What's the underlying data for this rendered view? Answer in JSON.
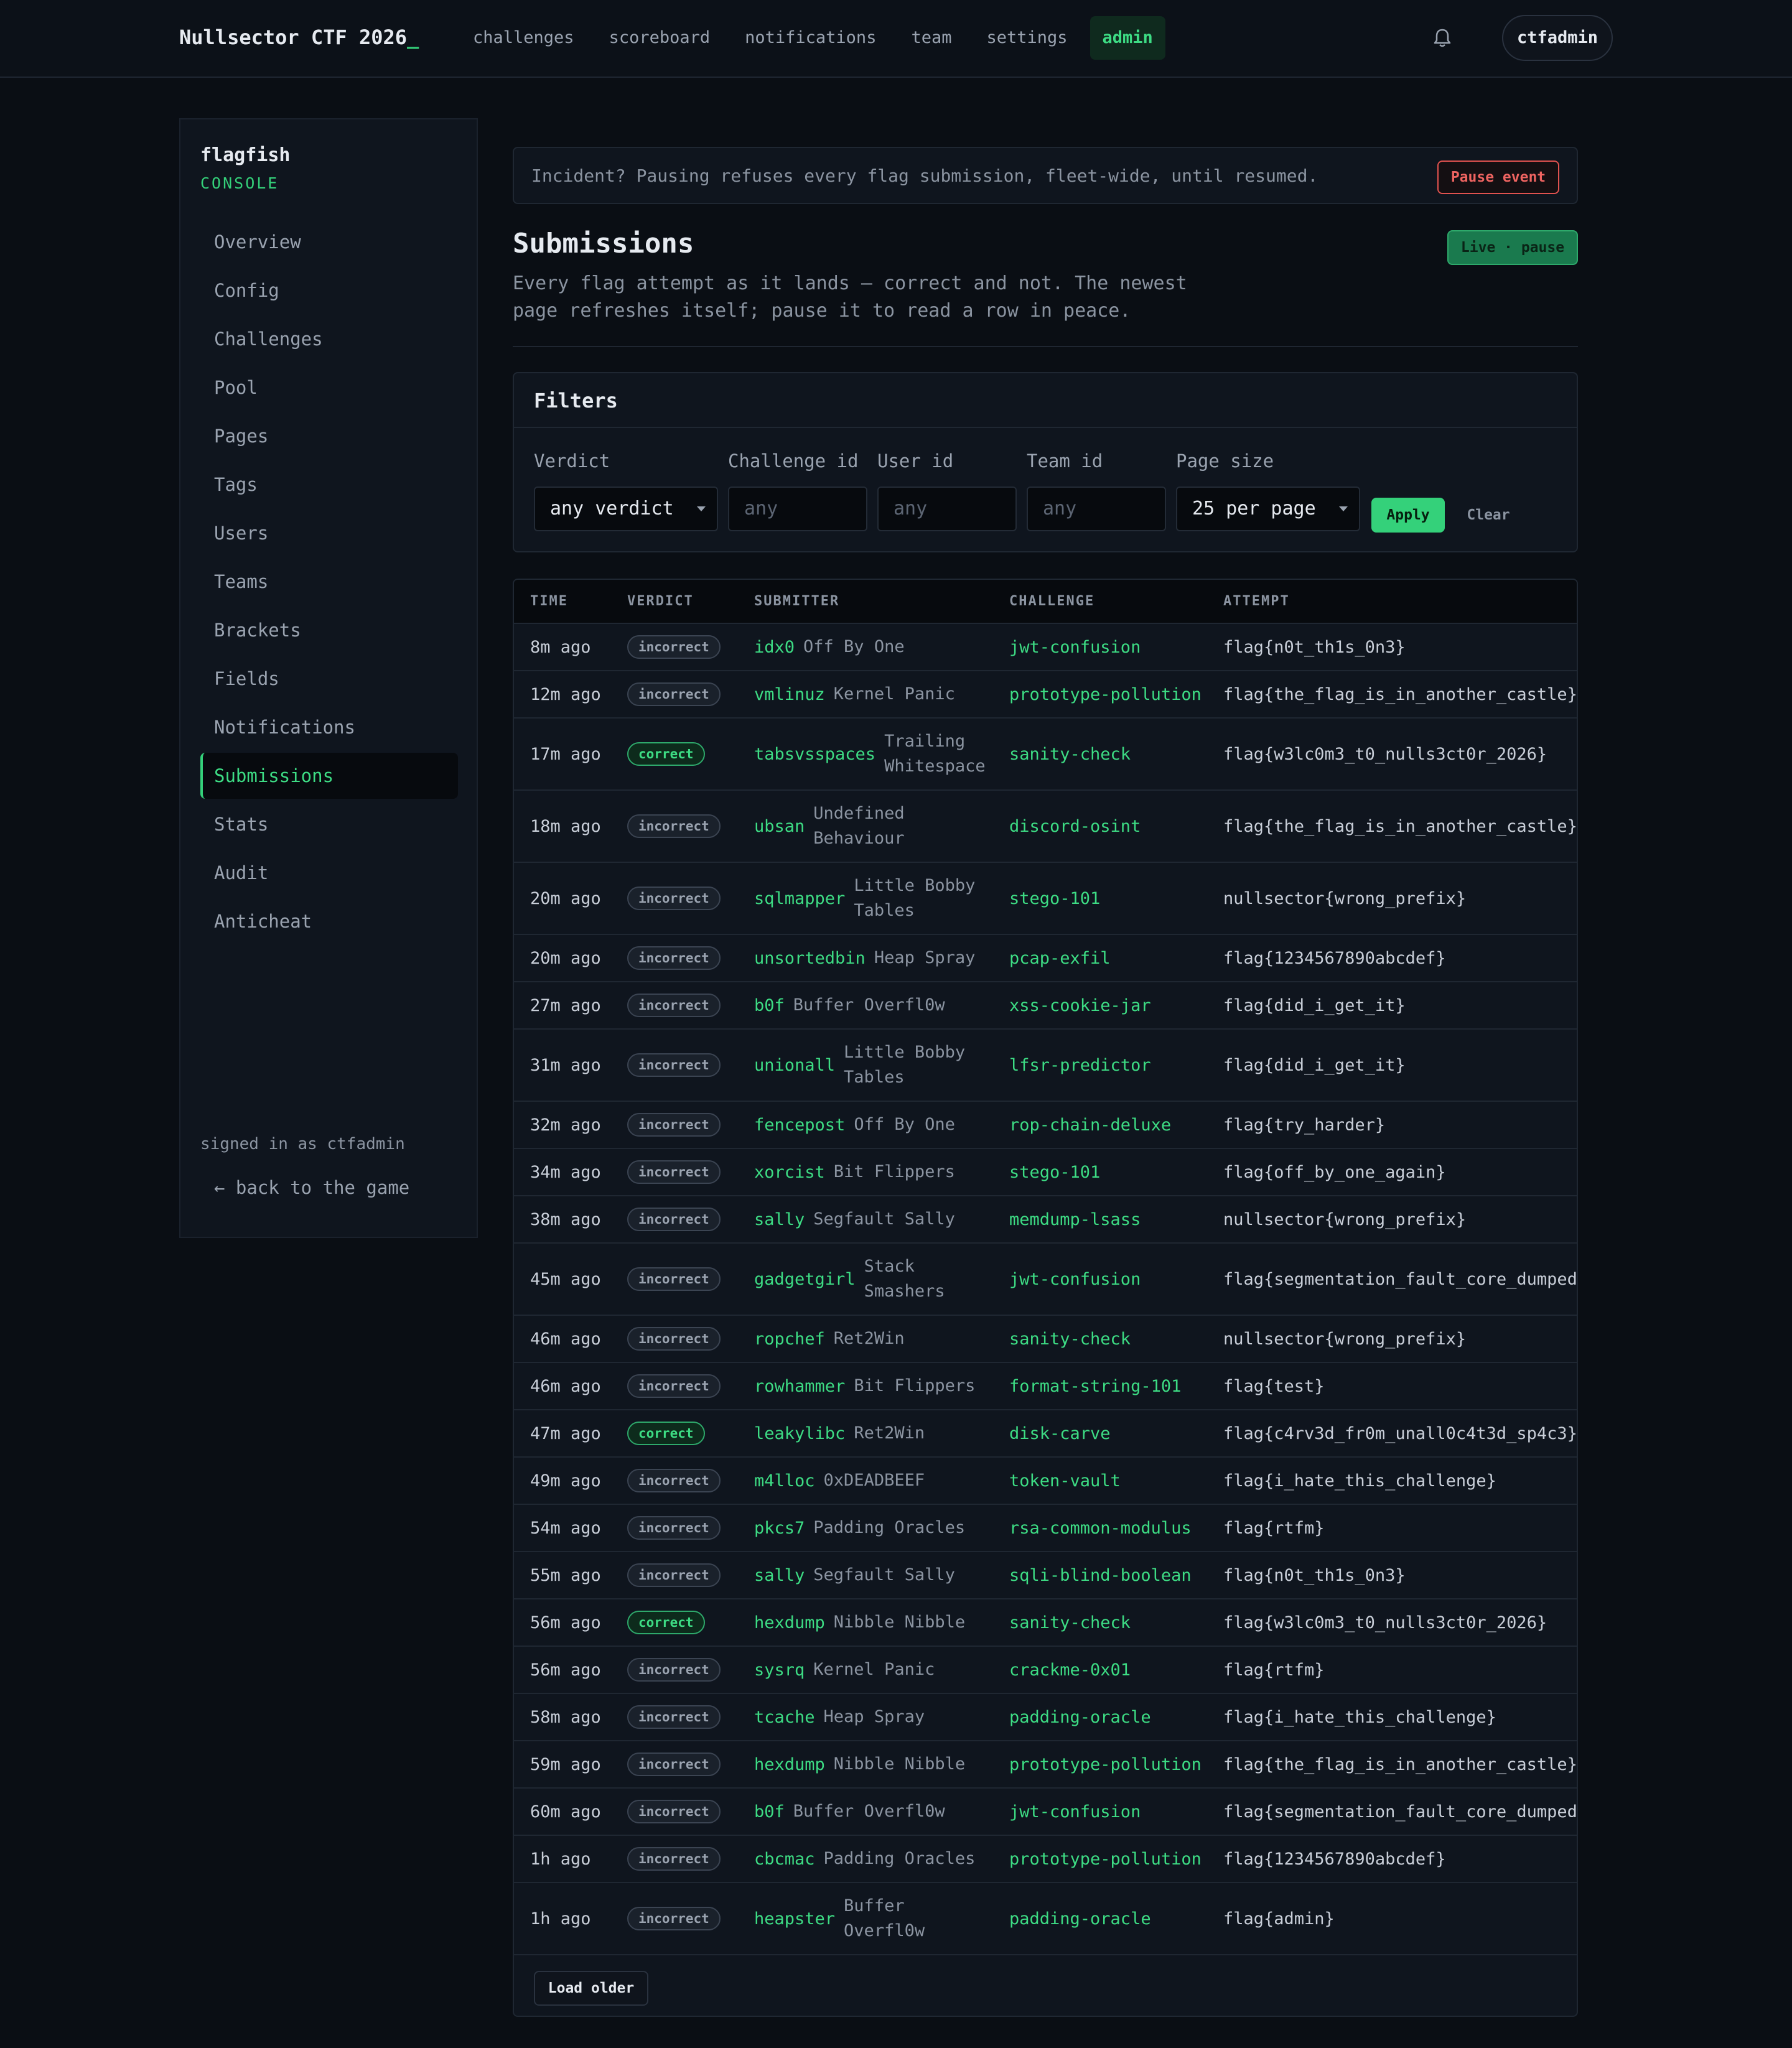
{
  "topbar": {
    "brand": "Nullsector CTF 2026",
    "brand_cursor": "_",
    "nav": [
      "challenges",
      "scoreboard",
      "notifications",
      "team",
      "settings",
      "admin"
    ],
    "active_nav": "admin",
    "bell_icon": "bell-icon",
    "user": "ctfadmin"
  },
  "sidebar": {
    "title": "flagfish",
    "subtitle": "CONSOLE",
    "items": [
      "Overview",
      "Config",
      "Challenges",
      "Pool",
      "Pages",
      "Tags",
      "Users",
      "Teams",
      "Brackets",
      "Fields",
      "Notifications",
      "Submissions",
      "Stats",
      "Audit",
      "Anticheat"
    ],
    "active": "Submissions",
    "signed_in": "signed in as ctfadmin",
    "back": "← back to the game"
  },
  "incident": {
    "text": "Incident? Pausing refuses every flag submission, fleet-wide, until resumed.",
    "button": "Pause event"
  },
  "page": {
    "title": "Submissions",
    "live_button": "Live · pause",
    "description": "Every flag attempt as it lands — correct and not. The newest page refreshes itself; pause it to read a row in peace."
  },
  "filters": {
    "title": "Filters",
    "verdict_label": "Verdict",
    "verdict_value": "any verdict",
    "challenge_label": "Challenge id",
    "challenge_placeholder": "any",
    "user_label": "User id",
    "user_placeholder": "any",
    "team_label": "Team id",
    "team_placeholder": "any",
    "pagesize_label": "Page size",
    "pagesize_value": "25 per page",
    "apply": "Apply",
    "clear": "Clear"
  },
  "table": {
    "columns": [
      "TIME",
      "VERDICT",
      "SUBMITTER",
      "CHALLENGE",
      "ATTEMPT"
    ],
    "rows": [
      {
        "time": "8m ago",
        "verdict": "incorrect",
        "handle": "idx0",
        "team": "Off By One",
        "challenge": "jwt-confusion",
        "attempt": "flag{n0t_th1s_0n3}"
      },
      {
        "time": "12m ago",
        "verdict": "incorrect",
        "handle": "vmlinuz",
        "team": "Kernel Panic",
        "challenge": "prototype-pollution",
        "attempt": "flag{the_flag_is_in_another_castle}"
      },
      {
        "time": "17m ago",
        "verdict": "correct",
        "handle": "tabsvsspaces",
        "team": "Trailing Whitespace",
        "challenge": "sanity-check",
        "attempt": "flag{w3lc0m3_t0_nulls3ct0r_2026}"
      },
      {
        "time": "18m ago",
        "verdict": "incorrect",
        "handle": "ubsan",
        "team": "Undefined Behaviour",
        "challenge": "discord-osint",
        "attempt": "flag{the_flag_is_in_another_castle}"
      },
      {
        "time": "20m ago",
        "verdict": "incorrect",
        "handle": "sqlmapper",
        "team": "Little Bobby Tables",
        "challenge": "stego-101",
        "attempt": "nullsector{wrong_prefix}"
      },
      {
        "time": "20m ago",
        "verdict": "incorrect",
        "handle": "unsortedbin",
        "team": "Heap Spray",
        "challenge": "pcap-exfil",
        "attempt": "flag{1234567890abcdef}"
      },
      {
        "time": "27m ago",
        "verdict": "incorrect",
        "handle": "b0f",
        "team": "Buffer Overfl0w",
        "challenge": "xss-cookie-jar",
        "attempt": "flag{did_i_get_it}"
      },
      {
        "time": "31m ago",
        "verdict": "incorrect",
        "handle": "unionall",
        "team": "Little Bobby Tables",
        "challenge": "lfsr-predictor",
        "attempt": "flag{did_i_get_it}"
      },
      {
        "time": "32m ago",
        "verdict": "incorrect",
        "handle": "fencepost",
        "team": "Off By One",
        "challenge": "rop-chain-deluxe",
        "attempt": "flag{try_harder}"
      },
      {
        "time": "34m ago",
        "verdict": "incorrect",
        "handle": "xorcist",
        "team": "Bit Flippers",
        "challenge": "stego-101",
        "attempt": "flag{off_by_one_again}"
      },
      {
        "time": "38m ago",
        "verdict": "incorrect",
        "handle": "sally",
        "team": "Segfault Sally",
        "challenge": "memdump-lsass",
        "attempt": "nullsector{wrong_prefix}"
      },
      {
        "time": "45m ago",
        "verdict": "incorrect",
        "handle": "gadgetgirl",
        "team": "Stack Smashers",
        "challenge": "jwt-confusion",
        "attempt": "flag{segmentation_fault_core_dumped}"
      },
      {
        "time": "46m ago",
        "verdict": "incorrect",
        "handle": "ropchef",
        "team": "Ret2Win",
        "challenge": "sanity-check",
        "attempt": "nullsector{wrong_prefix}"
      },
      {
        "time": "46m ago",
        "verdict": "incorrect",
        "handle": "rowhammer",
        "team": "Bit Flippers",
        "challenge": "format-string-101",
        "attempt": "flag{test}"
      },
      {
        "time": "47m ago",
        "verdict": "correct",
        "handle": "leakylibc",
        "team": "Ret2Win",
        "challenge": "disk-carve",
        "attempt": "flag{c4rv3d_fr0m_unall0c4t3d_sp4c3}"
      },
      {
        "time": "49m ago",
        "verdict": "incorrect",
        "handle": "m4lloc",
        "team": "0xDEADBEEF",
        "challenge": "token-vault",
        "attempt": "flag{i_hate_this_challenge}"
      },
      {
        "time": "54m ago",
        "verdict": "incorrect",
        "handle": "pkcs7",
        "team": "Padding Oracles",
        "challenge": "rsa-common-modulus",
        "attempt": "flag{rtfm}"
      },
      {
        "time": "55m ago",
        "verdict": "incorrect",
        "handle": "sally",
        "team": "Segfault Sally",
        "challenge": "sqli-blind-boolean",
        "attempt": "flag{n0t_th1s_0n3}"
      },
      {
        "time": "56m ago",
        "verdict": "correct",
        "handle": "hexdump",
        "team": "Nibble Nibble",
        "challenge": "sanity-check",
        "attempt": "flag{w3lc0m3_t0_nulls3ct0r_2026}"
      },
      {
        "time": "56m ago",
        "verdict": "incorrect",
        "handle": "sysrq",
        "team": "Kernel Panic",
        "challenge": "crackme-0x01",
        "attempt": "flag{rtfm}"
      },
      {
        "time": "58m ago",
        "verdict": "incorrect",
        "handle": "tcache",
        "team": "Heap Spray",
        "challenge": "padding-oracle",
        "attempt": "flag{i_hate_this_challenge}"
      },
      {
        "time": "59m ago",
        "verdict": "incorrect",
        "handle": "hexdump",
        "team": "Nibble Nibble",
        "challenge": "prototype-pollution",
        "attempt": "flag{the_flag_is_in_another_castle}"
      },
      {
        "time": "60m ago",
        "verdict": "incorrect",
        "handle": "b0f",
        "team": "Buffer Overfl0w",
        "challenge": "jwt-confusion",
        "attempt": "flag{segmentation_fault_core_dumped}"
      },
      {
        "time": "1h ago",
        "verdict": "incorrect",
        "handle": "cbcmac",
        "team": "Padding Oracles",
        "challenge": "prototype-pollution",
        "attempt": "flag{1234567890abcdef}"
      },
      {
        "time": "1h ago",
        "verdict": "incorrect",
        "handle": "heapster",
        "team": "Buffer Overfl0w",
        "challenge": "padding-oracle",
        "attempt": "flag{admin}"
      }
    ],
    "load_older": "Load older"
  },
  "colors": {
    "accent": "#3ddc84",
    "danger": "#ef6461",
    "background": "#0a0e14"
  }
}
